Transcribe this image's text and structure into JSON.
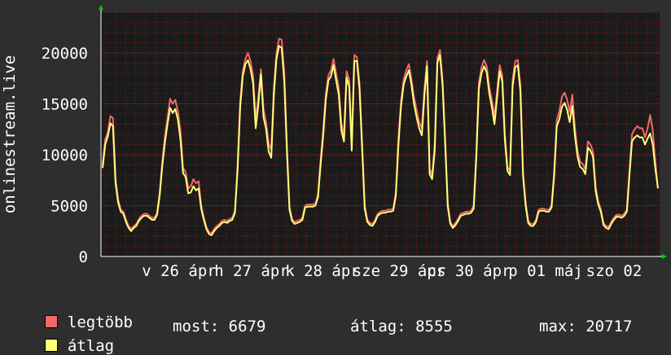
{
  "chart_data": {
    "type": "line",
    "ylabel": "onlinestream.live",
    "ylim": [
      0,
      24000
    ],
    "yticks": [
      0,
      5000,
      10000,
      15000,
      20000
    ],
    "grid": true,
    "xticks": [
      "v 26 ápr",
      "h 27 ápr",
      "k 28 ápr",
      "sze 29 ápr",
      "cs 30 ápr",
      "p 01 máj",
      "szo 02"
    ],
    "series": [
      {
        "name": "legtöbb",
        "color": "#f06a6a",
        "values": [
          9000,
          11500,
          12200,
          13800,
          13600,
          7600,
          5600,
          4600,
          4400,
          3600,
          3000,
          2700,
          3000,
          3200,
          3700,
          4000,
          4200,
          4200,
          4000,
          3800,
          3800,
          4300,
          6300,
          9300,
          11800,
          13600,
          15500,
          15000,
          15400,
          14300,
          12400,
          8700,
          8300,
          6700,
          6900,
          7600,
          7200,
          7400,
          5000,
          3800,
          2900,
          2400,
          2300,
          2700,
          3000,
          3200,
          3500,
          3600,
          3500,
          3700,
          3800,
          4500,
          8800,
          15200,
          18200,
          19400,
          20000,
          19200,
          17800,
          13400,
          15600,
          18400,
          14500,
          13200,
          11100,
          10500,
          16600,
          20000,
          21400,
          21300,
          18000,
          11000,
          4900,
          3700,
          3400,
          3500,
          3600,
          3800,
          5000,
          5100,
          5100,
          5100,
          5200,
          6100,
          9500,
          12400,
          16000,
          17800,
          18300,
          19400,
          18000,
          16600,
          13100,
          11900,
          18200,
          17400,
          11000,
          19800,
          19600,
          17000,
          11200,
          5000,
          3600,
          3300,
          3200,
          3600,
          4200,
          4400,
          4500,
          4500,
          4600,
          4600,
          4700,
          6300,
          11600,
          15300,
          17400,
          18300,
          18900,
          17500,
          15700,
          14400,
          13200,
          12600,
          16500,
          19200,
          8600,
          8000,
          11000,
          19500,
          20300,
          17300,
          11500,
          5200,
          3400,
          3000,
          3300,
          3700,
          4200,
          4300,
          4400,
          4400,
          4500,
          5000,
          10200,
          17100,
          18600,
          19300,
          18700,
          16600,
          15400,
          13700,
          16300,
          18800,
          17800,
          12000,
          8800,
          8400,
          17400,
          19200,
          19300,
          16800,
          8300,
          5300,
          3500,
          3200,
          3200,
          3600,
          4600,
          4700,
          4700,
          4600,
          4600,
          5000,
          8300,
          13400,
          14300,
          15700,
          16100,
          15400,
          14200,
          15900,
          12700,
          10400,
          9300,
          9100,
          8600,
          11300,
          11000,
          10300,
          6800,
          5400,
          4600,
          3300,
          3000,
          2900,
          3400,
          3800,
          4100,
          4100,
          4000,
          4200,
          4600,
          8300,
          12000,
          12500,
          12800,
          12600,
          12600,
          11700,
          12600,
          13900,
          12400,
          9300,
          6700
        ]
      },
      {
        "name": "átlag",
        "color": "#ffff7a",
        "values": [
          8700,
          11000,
          11800,
          13100,
          12800,
          7200,
          5300,
          4400,
          4200,
          3400,
          2800,
          2500,
          2800,
          3000,
          3500,
          3800,
          4000,
          4000,
          3800,
          3600,
          3600,
          4100,
          6000,
          8900,
          11200,
          13000,
          14600,
          14100,
          14500,
          13500,
          11500,
          8200,
          7800,
          6200,
          6300,
          6900,
          6500,
          6700,
          4700,
          3600,
          2700,
          2200,
          2100,
          2500,
          2800,
          3000,
          3300,
          3400,
          3300,
          3500,
          3600,
          4300,
          8400,
          14600,
          17700,
          18900,
          19300,
          18400,
          17000,
          12600,
          14900,
          17900,
          13700,
          12500,
          10300,
          9700,
          15900,
          19400,
          20700,
          20500,
          17200,
          10400,
          4600,
          3500,
          3200,
          3300,
          3400,
          3600,
          4800,
          4900,
          4900,
          4900,
          5000,
          5800,
          9000,
          11900,
          15400,
          17300,
          17700,
          18800,
          17300,
          15900,
          12400,
          11300,
          17600,
          16700,
          10400,
          19200,
          19200,
          16400,
          10600,
          4700,
          3400,
          3100,
          3000,
          3400,
          4000,
          4200,
          4300,
          4300,
          4400,
          4400,
          4500,
          6000,
          11000,
          14800,
          16900,
          17700,
          18300,
          16900,
          15000,
          13700,
          12600,
          11900,
          15800,
          18700,
          8100,
          7600,
          10500,
          19000,
          19800,
          16800,
          11000,
          4900,
          3200,
          2800,
          3100,
          3500,
          4000,
          4100,
          4200,
          4200,
          4300,
          4700,
          9700,
          16500,
          18000,
          18700,
          18100,
          16000,
          14700,
          13000,
          15600,
          18200,
          17200,
          11400,
          8400,
          8000,
          16700,
          18600,
          18800,
          16200,
          7900,
          5000,
          3300,
          3000,
          3000,
          3400,
          4400,
          4500,
          4500,
          4400,
          4400,
          4800,
          7900,
          12800,
          13500,
          14700,
          15100,
          14400,
          13200,
          14800,
          11900,
          9800,
          8800,
          8600,
          8100,
          10700,
          10400,
          9800,
          6400,
          5100,
          4400,
          3100,
          2800,
          2700,
          3200,
          3600,
          3900,
          3900,
          3800,
          4000,
          4400,
          7900,
          11300,
          11700,
          11900,
          11700,
          11700,
          11000,
          11600,
          12100,
          11000,
          8600,
          6700
        ]
      }
    ]
  },
  "legend": {
    "max_label": "legtöbb",
    "avg_label": "átlag",
    "now": "most: 6679",
    "avg": "átlag: 8555",
    "max": "max: 20717"
  },
  "colors": {
    "background": "#2e2e2e",
    "plot": "#1b1b1b",
    "grid": "#7a1f1f",
    "axis": "#ffffff",
    "arrow": "#00cc00"
  }
}
